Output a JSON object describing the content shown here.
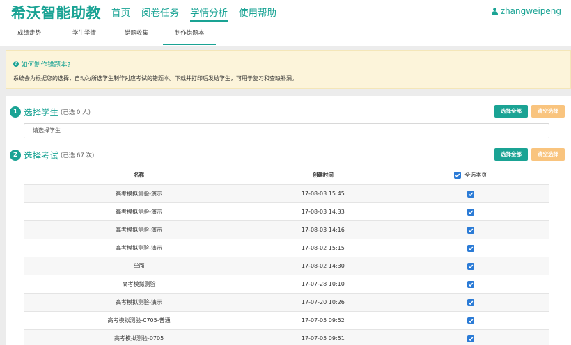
{
  "brand": "希沃智能助教",
  "nav": [
    "首页",
    "阅卷任务",
    "学情分析",
    "使用帮助"
  ],
  "nav_active": 2,
  "user": "zhangweipeng",
  "subtabs": [
    "成绩走势",
    "学生学情",
    "错题收集",
    "制作错题本"
  ],
  "subtab_active": 3,
  "info": {
    "title": "如何制作错题本?",
    "text": "系统会为根据您的选择，自动为所选学生制作对应考试的错题本。下载并打印后发给学生，可用于复习和查缺补漏。"
  },
  "step1": {
    "num": "1",
    "title": "选择学生",
    "count": "(已选 0 人)",
    "btn_all": "选择全部",
    "btn_clear": "清空选择",
    "placeholder": "请选择学生"
  },
  "step2": {
    "num": "2",
    "title": "选择考试",
    "count": "(已选 67 次)",
    "btn_all": "选择全部",
    "btn_clear": "清空选择"
  },
  "table": {
    "headers": [
      "名称",
      "创建时间",
      "全选本页"
    ],
    "rows": [
      {
        "name": "高考模拟测验-演示",
        "time": "17-08-03 15:45",
        "checked": true
      },
      {
        "name": "高考模拟测验-演示",
        "time": "17-08-03 14:33",
        "checked": true
      },
      {
        "name": "高考模拟测验-演示",
        "time": "17-08-03 14:16",
        "checked": true
      },
      {
        "name": "高考模拟测验-演示",
        "time": "17-08-02 15:15",
        "checked": true
      },
      {
        "name": "单面",
        "time": "17-08-02 14:30",
        "checked": true
      },
      {
        "name": "高考模拟测验",
        "time": "17-07-28 10:10",
        "checked": true
      },
      {
        "name": "高考模拟测验-演示",
        "time": "17-07-20 10:26",
        "checked": true
      },
      {
        "name": "高考模拟测验-0705-普通",
        "time": "17-07-05 09:52",
        "checked": true
      },
      {
        "name": "高考模拟测验-0705",
        "time": "17-07-05 09:51",
        "checked": true
      }
    ]
  },
  "colors": {
    "accent": "#1aa394",
    "orange": "#f9c47e",
    "checkbox": "#2b7bd6",
    "info_bg": "#fcf4da"
  }
}
